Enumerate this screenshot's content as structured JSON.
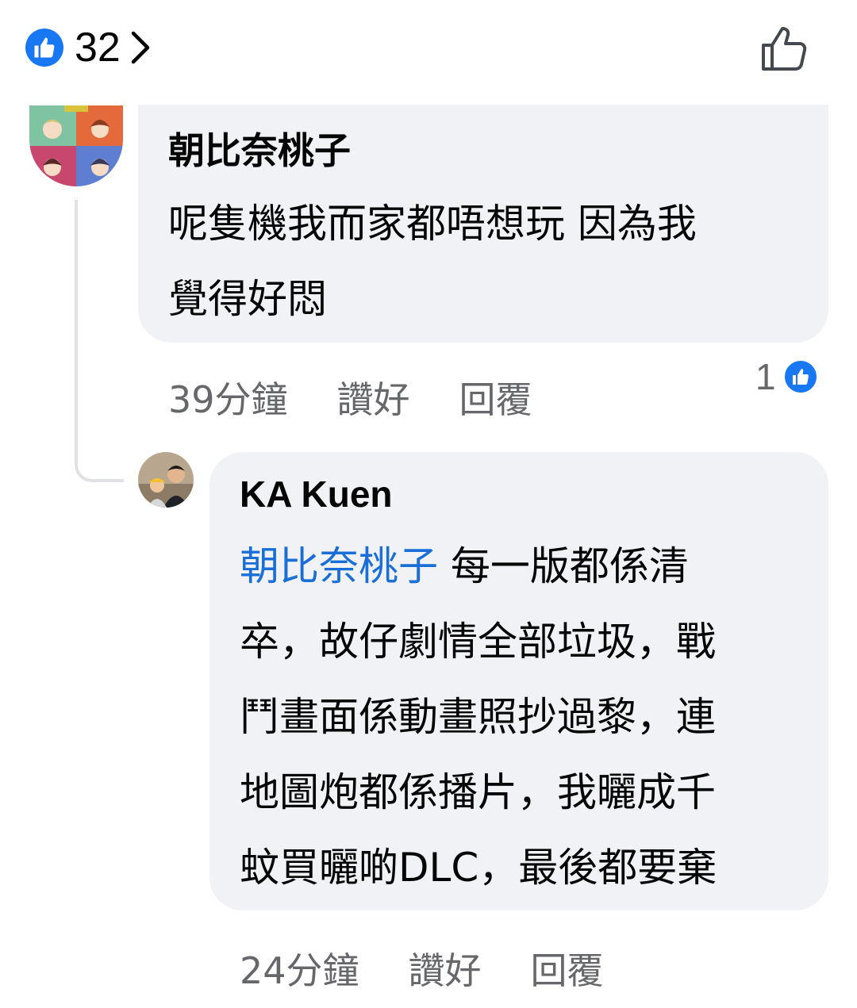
{
  "reactions": {
    "count": "32",
    "icon": "like-icon",
    "accent": "#1877f2"
  },
  "comments": [
    {
      "author": "朝比奈桃子",
      "text_lines": [
        "呢隻機我而家都唔想玩 因為我",
        "覺得好悶"
      ],
      "time": "39分鐘",
      "like_label": "讚好",
      "reply_label": "回覆",
      "reaction_count": "1"
    },
    {
      "author": "KA Kuen",
      "mention": "朝比奈桃子",
      "text_first": " 每一版都係清",
      "text_lines": [
        "卒，故仔劇情全部垃圾，戰",
        "鬥畫面係動畫照抄過黎，連",
        "地圖炮都係播片，我曬成千",
        "蚊買曬啲DLC，最後都要棄"
      ],
      "time": "24分鐘",
      "like_label": "讚好",
      "reply_label": "回覆"
    }
  ]
}
